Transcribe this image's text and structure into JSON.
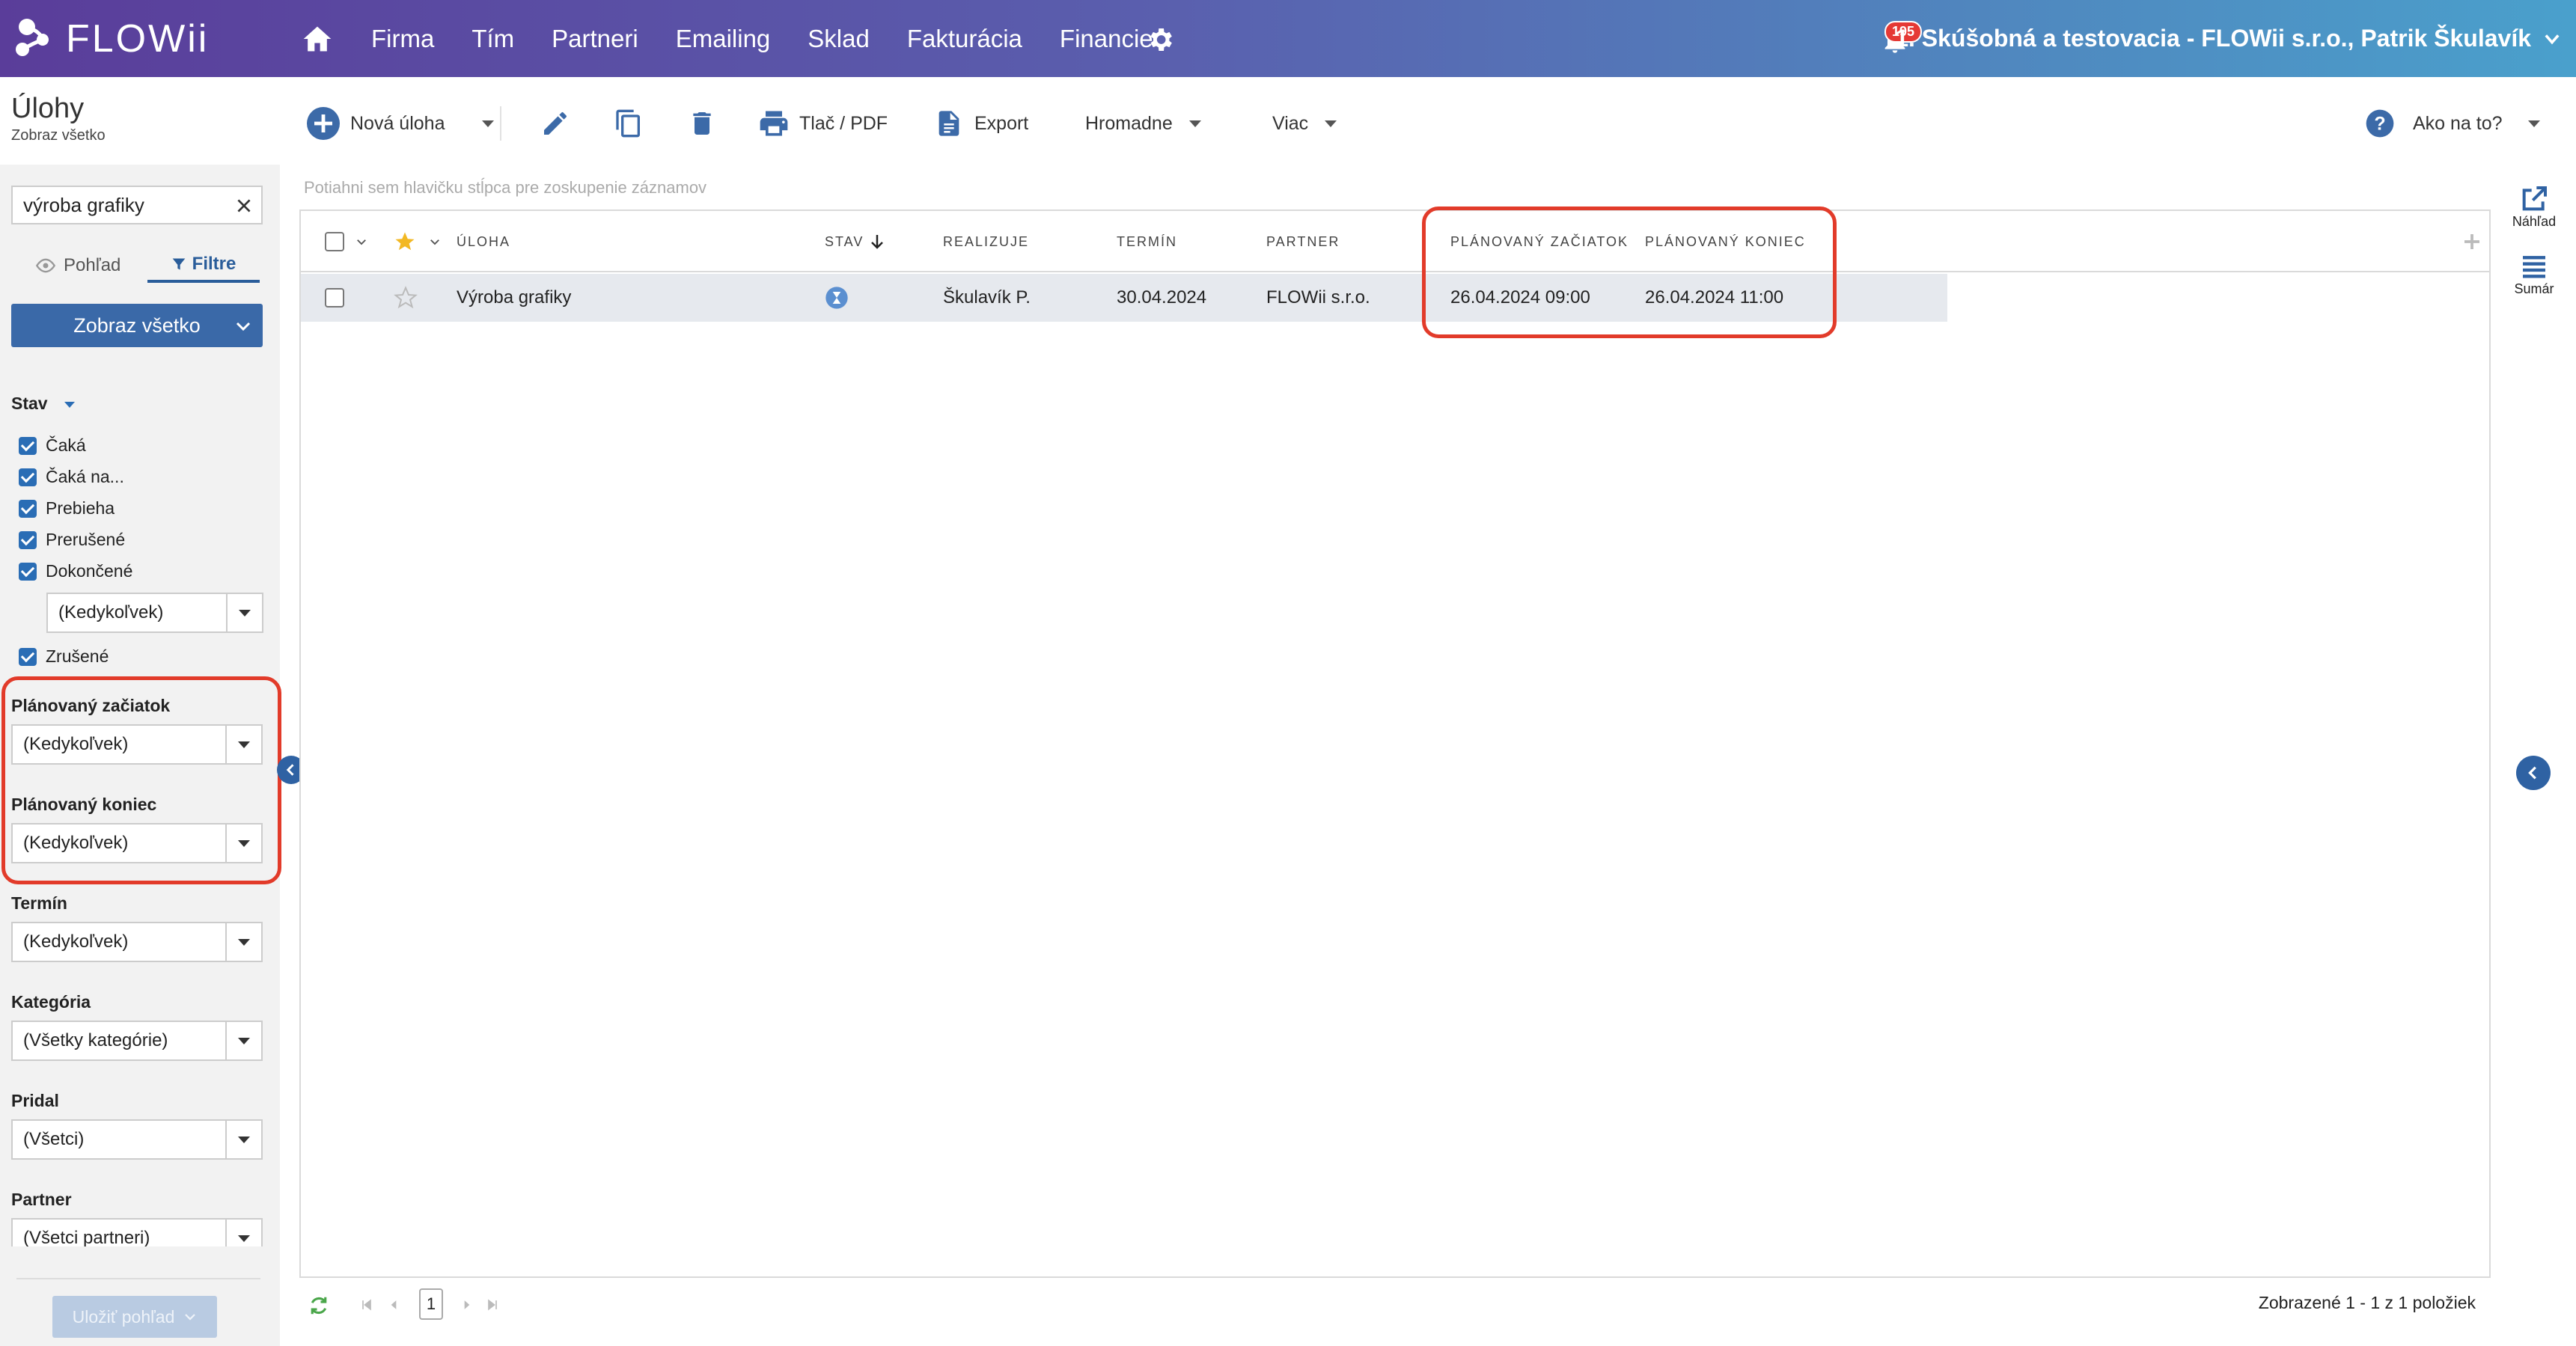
{
  "topbar": {
    "logo": "FLOWii",
    "nav": [
      "Firma",
      "Tím",
      "Partneri",
      "Emailing",
      "Sklad",
      "Fakturácia",
      "Financie"
    ],
    "notification_count": "195",
    "company": "1. Skúšobná a testovacia - FLOWii s.r.o., Patrik Škulavík",
    "colors": {
      "gradient_start": "#5a3d9a",
      "gradient_end": "#4aa0cc"
    }
  },
  "page": {
    "title": "Úlohy",
    "subtitle": "Zobraz všetko"
  },
  "toolbar": {
    "new_task": "Nová úloha",
    "print": "Tlač / PDF",
    "export": "Export",
    "bulk": "Hromadne",
    "more": "Viac",
    "help": "Ako na to?"
  },
  "sidebar": {
    "search_value": "výroba grafiky",
    "tabs": {
      "view": "Pohľad",
      "filters": "Filtre"
    },
    "show_all": "Zobraz všetko",
    "status": {
      "label": "Stav",
      "items": [
        "Čaká",
        "Čaká na...",
        "Prebieha",
        "Prerušené",
        "Dokončené"
      ],
      "completed_range": "(Kedykoľvek)",
      "cancelled": "Zrušené"
    },
    "planned_start": {
      "label": "Plánovaný začiatok",
      "value": "(Kedykoľvek)"
    },
    "planned_end": {
      "label": "Plánovaný koniec",
      "value": "(Kedykoľvek)"
    },
    "deadline": {
      "label": "Termín",
      "value": "(Kedykoľvek)"
    },
    "category": {
      "label": "Kategória",
      "value": "(Všetky kategórie)"
    },
    "added_by": {
      "label": "Pridal",
      "value": "(Všetci)"
    },
    "partner": {
      "label": "Partner",
      "value": "(Všetci partneri)"
    },
    "save_view": "Uložiť pohľad"
  },
  "grid": {
    "group_hint": "Potiahni sem hlavičku stĺpca pre zoskupenie záznamov",
    "columns": {
      "task": "ÚLOHA",
      "status": "STAV",
      "assignee": "REALIZUJE",
      "deadline": "TERMÍN",
      "partner": "PARTNER",
      "planned_start": "PLÁNOVANÝ ZAČIATOK",
      "planned_end": "PLÁNOVANÝ KONIEC"
    },
    "rows": [
      {
        "task": "Výroba grafiky",
        "assignee": "Škulavík P.",
        "deadline": "30.04.2024",
        "partner": "FLOWii s.r.o.",
        "planned_start": "26.04.2024 09:00",
        "planned_end": "26.04.2024 11:00"
      }
    ]
  },
  "pager": {
    "page": "1",
    "summary": "Zobrazené 1 - 1 z 1 položiek"
  },
  "rail": {
    "preview": "Náhľad",
    "summary": "Sumár"
  },
  "highlight_color": "#e23b2a"
}
